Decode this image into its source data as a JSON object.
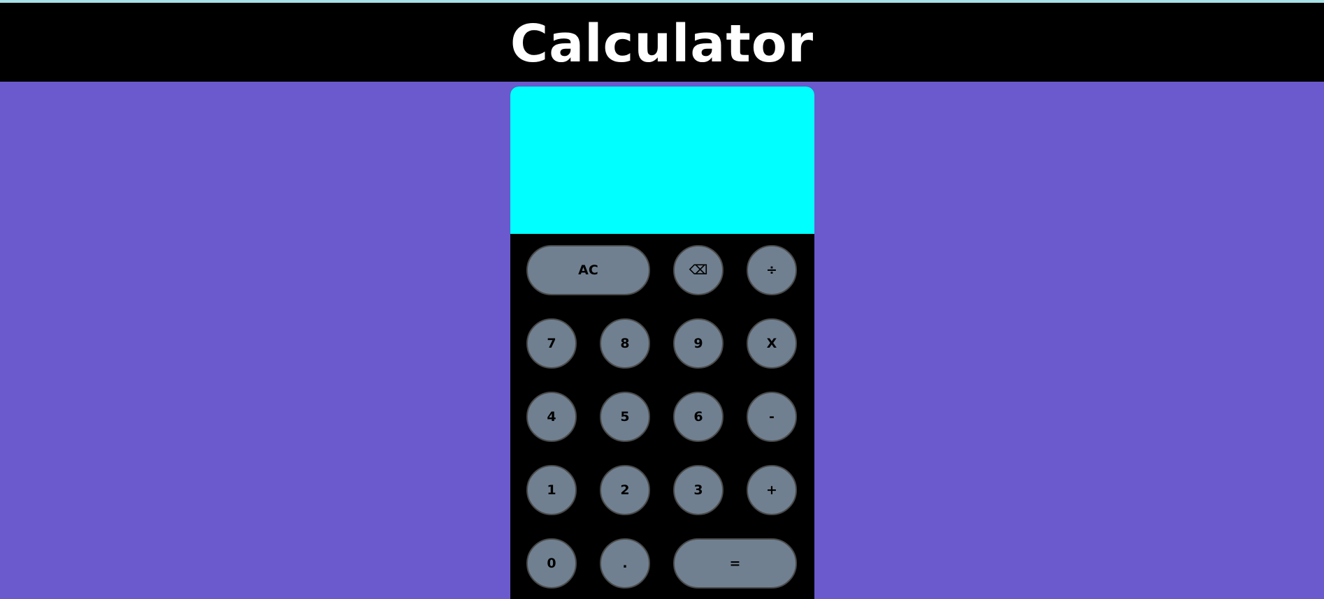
{
  "header": {
    "title": "Calculator"
  },
  "display": {
    "previous": "",
    "current": ""
  },
  "keys": {
    "ac": "AC",
    "backspace": "⌫",
    "divide": "÷",
    "seven": "7",
    "eight": "8",
    "nine": "9",
    "multiply": "X",
    "four": "4",
    "five": "5",
    "six": "6",
    "minus": "-",
    "one": "1",
    "two": "2",
    "three": "3",
    "plus": "+",
    "zero": "0",
    "dot": ".",
    "equals": "="
  },
  "colors": {
    "page_background": "#6a5acd",
    "header_background": "#000000",
    "display_background": "#00ffff",
    "key_background": "#708090",
    "key_border": "#4a4a4a"
  }
}
